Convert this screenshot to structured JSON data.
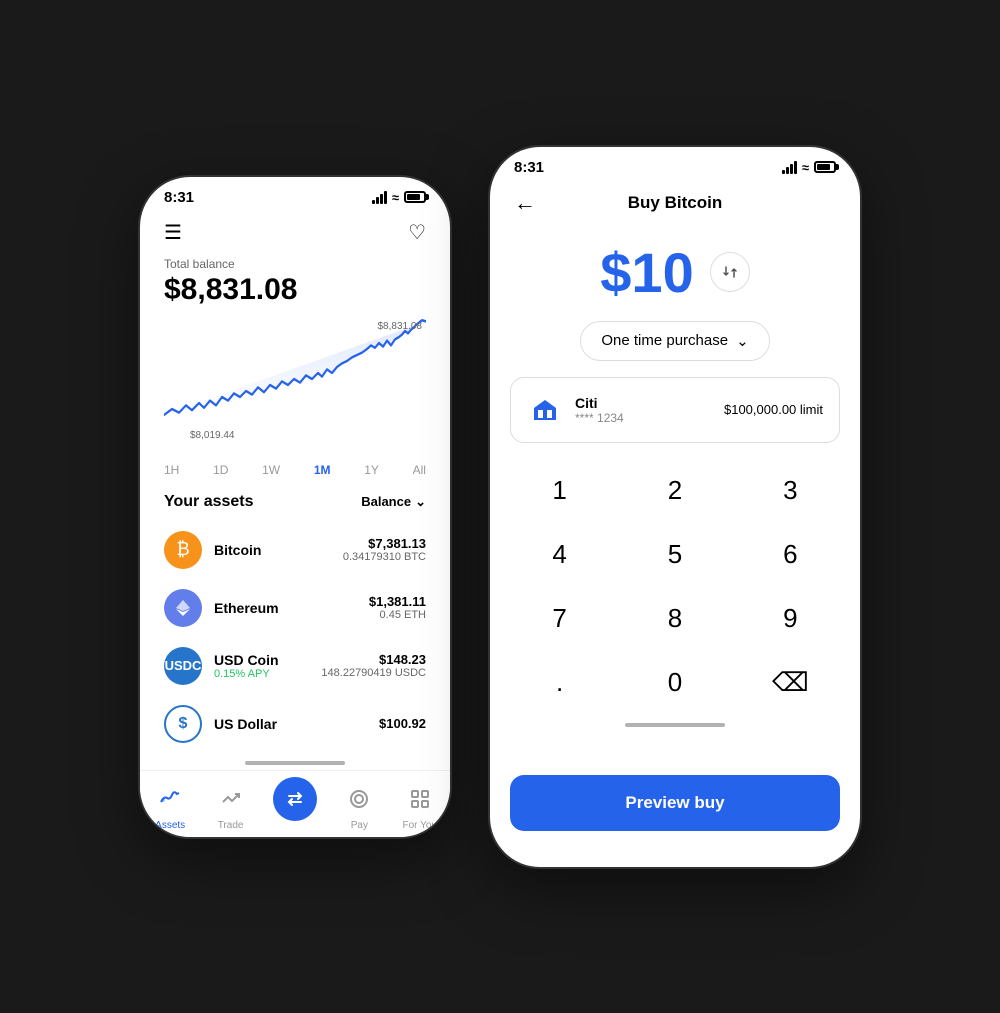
{
  "left_phone": {
    "status": {
      "time": "8:31"
    },
    "balance": {
      "label": "Total balance",
      "amount": "$8,831.08"
    },
    "chart": {
      "high_label": "$8,831.08",
      "low_label": "$8,019.44"
    },
    "time_filters": [
      "1H",
      "1D",
      "1W",
      "1M",
      "1Y",
      "All"
    ],
    "active_filter": "1M",
    "assets_title": "Your assets",
    "balance_sort": "Balance",
    "assets": [
      {
        "name": "Bitcoin",
        "type": "btc",
        "usd": "$7,381.13",
        "crypto": "0.34179310 BTC",
        "apy": null
      },
      {
        "name": "Ethereum",
        "type": "eth",
        "usd": "$1,381.11",
        "crypto": "0.45 ETH",
        "apy": null
      },
      {
        "name": "USD Coin",
        "type": "usdc",
        "usd": "$148.23",
        "crypto": "148.22790419 USDC",
        "apy": "0.15% APY"
      },
      {
        "name": "US Dollar",
        "type": "usd",
        "usd": "$100.92",
        "crypto": null,
        "apy": null
      }
    ],
    "nav_items": [
      {
        "label": "Assets",
        "active": true
      },
      {
        "label": "Trade",
        "active": false
      },
      {
        "label": "",
        "active": false,
        "swap": true
      },
      {
        "label": "Pay",
        "active": false
      },
      {
        "label": "For You",
        "active": false
      }
    ]
  },
  "right_phone": {
    "status": {
      "time": "8:31"
    },
    "header": {
      "title": "Buy Bitcoin",
      "back_label": "←"
    },
    "amount": "$10",
    "purchase_type": "One time purchase",
    "payment": {
      "bank_name": "Citi",
      "account": "**** 1234",
      "limit": "$100,000.00 limit"
    },
    "numpad": [
      [
        "1",
        "2",
        "3"
      ],
      [
        "4",
        "5",
        "6"
      ],
      [
        "7",
        "8",
        "9"
      ],
      [
        ".",
        "0",
        "⌫"
      ]
    ],
    "preview_btn": "Preview buy"
  }
}
